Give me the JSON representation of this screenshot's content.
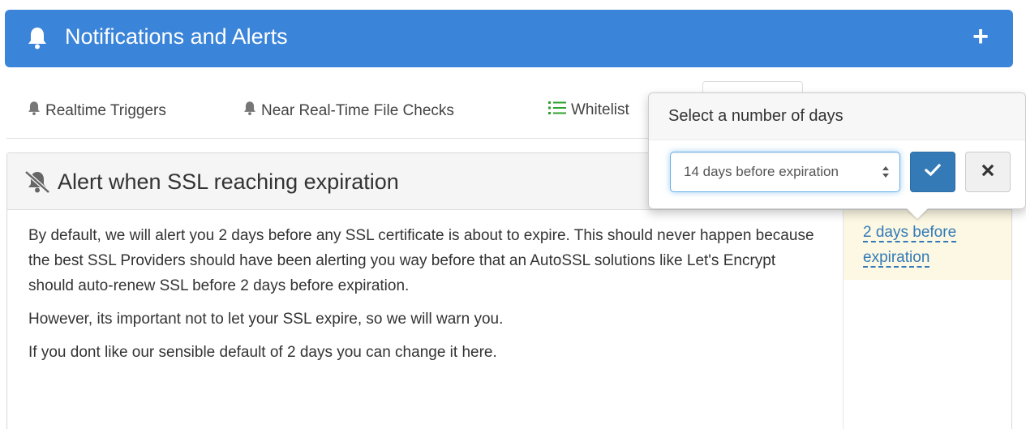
{
  "header": {
    "title": "Notifications and Alerts",
    "add_symbol": "+",
    "bell_icon": "bell-icon",
    "background_color": "#3a84d9"
  },
  "tabs": [
    {
      "label": "Realtime Triggers",
      "icon": "bell-icon"
    },
    {
      "label": "Near Real-Time File Checks",
      "icon": "bell-icon"
    },
    {
      "label": "Whitelist",
      "icon": "list-icon",
      "icon_color": "#2ca02c"
    }
  ],
  "panel": {
    "title": "Alert when SSL reaching expiration",
    "title_icon": "bell-slash-icon",
    "paragraphs": [
      "By default, we will alert you 2 days before any SSL certificate is about to expire. This should never happen because the best SSL Providers should have been alerting you way before that an AutoSSL solutions like Let's Encrypt should auto-renew SSL before 2 days before expiration.",
      "However, its important not to let your SSL expire, so we will warn you.",
      "If you dont like our sensible default of 2 days you can change it here."
    ],
    "setting_value": "2 days before expiration"
  },
  "popover": {
    "title": "Select a number of days",
    "select_value": "14 days before expiration",
    "confirm_icon": "check-icon",
    "cancel_icon": "close-icon"
  }
}
